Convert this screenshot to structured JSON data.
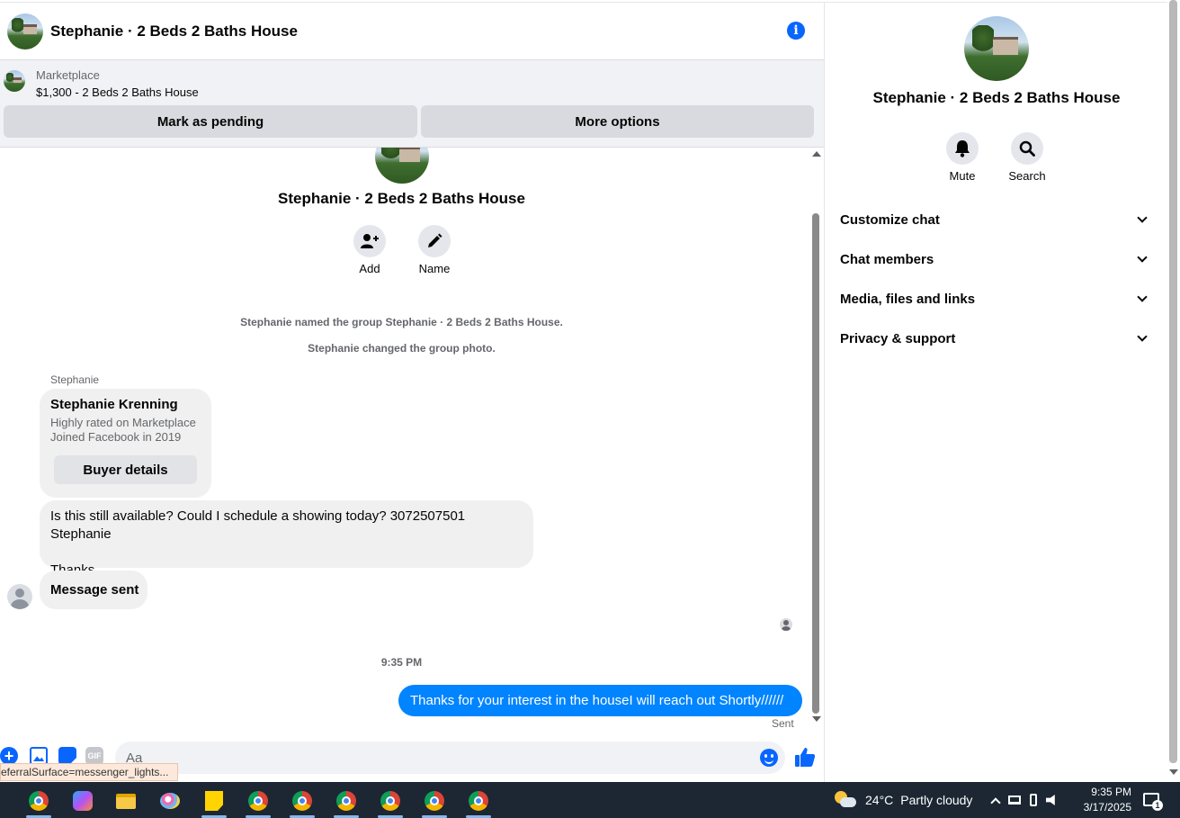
{
  "chat": {
    "header": {
      "title": "Stephanie · 2 Beds 2 Baths House"
    },
    "marketplace": {
      "label": "Marketplace",
      "listing": "$1,300 - 2 Beds 2 Baths House",
      "mark_pending": "Mark as pending",
      "more_options": "More options"
    },
    "conversation": {
      "title": "Stephanie · 2 Beds 2 Baths House",
      "add_label": "Add",
      "name_label": "Name",
      "system_messages": [
        "Stephanie named the group Stephanie · 2 Beds 2 Baths House.",
        "Stephanie changed the group photo."
      ],
      "sender_name": "Stephanie",
      "buyer_card": {
        "name": "Stephanie Krenning",
        "line1": "Highly rated on Marketplace",
        "line2": "Joined Facebook in 2019",
        "button": "Buyer details"
      },
      "message_1_line1": "Is this still available? Could I schedule a showing today? 3072507501 Stephanie",
      "message_1_line2": "Thanks",
      "message_2": "Message sent",
      "timestamp": "9:35 PM",
      "outgoing_message": "Thanks for your interest in the houseI will reach out Shortly//////",
      "sent_status": "Sent"
    },
    "composer": {
      "placeholder": "Aa",
      "gif_label": "GIF"
    },
    "status_url": "eferralSurface=messenger_lights..."
  },
  "right_panel": {
    "title": "Stephanie · 2 Beds 2 Baths House",
    "mute_label": "Mute",
    "search_label": "Search",
    "sections": [
      "Customize chat",
      "Chat members",
      "Media, files and links",
      "Privacy & support"
    ]
  },
  "taskbar": {
    "weather_temp": "24°C",
    "weather_desc": "Partly cloudy",
    "time": "9:35 PM",
    "date": "3/17/2025",
    "notification_count": "1",
    "colors": {
      "background": "#1c2733",
      "accent": "#0866ff",
      "outgoing_bubble": "#0084ff"
    }
  }
}
